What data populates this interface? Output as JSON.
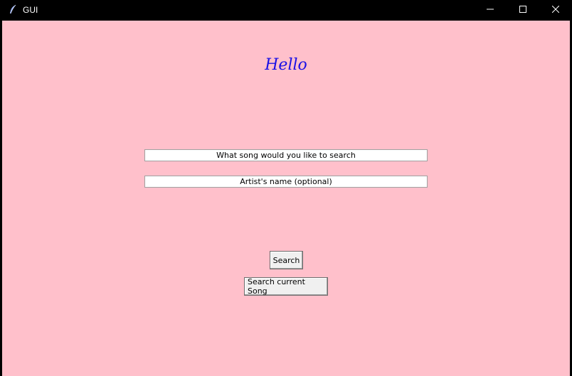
{
  "window": {
    "title": "GUI",
    "icon": "feather-icon",
    "controls": [
      "minimize-icon",
      "maximize-icon",
      "close-icon"
    ]
  },
  "main": {
    "greeting": "Hello",
    "song_entry_value": "What song would you like to search",
    "artist_entry_value": "Artist's name (optional)",
    "search_button_label": "Search",
    "search_current_button_label": "Search current Song"
  },
  "colors": {
    "background": "#ffc0cb",
    "greeting": "#1a10e6",
    "titlebar": "#000000"
  }
}
